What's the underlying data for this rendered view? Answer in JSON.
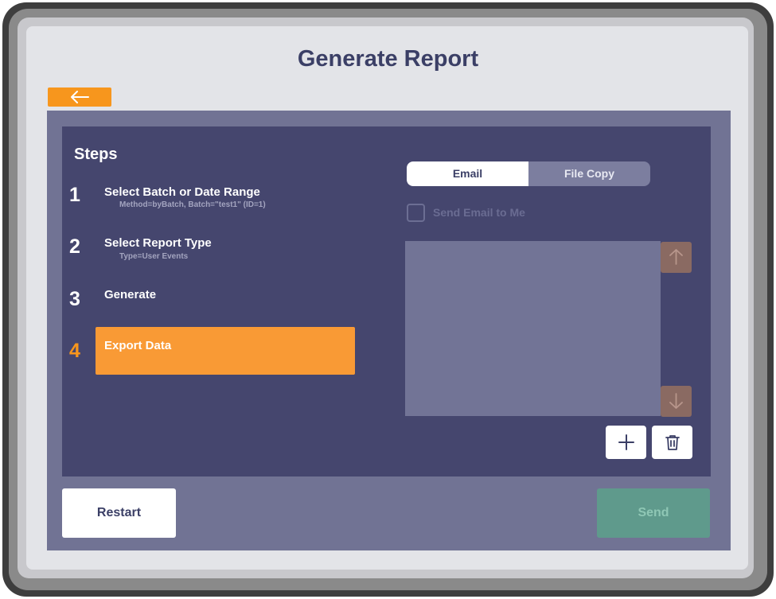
{
  "header": {
    "title": "Generate Report",
    "back_icon": "arrow-left-icon"
  },
  "steps": {
    "heading": "Steps",
    "items": [
      {
        "number": "1",
        "label": "Select Batch or Date Range",
        "detail": "Method=byBatch, Batch=\"test1\" (ID=1)",
        "active": false
      },
      {
        "number": "2",
        "label": "Select Report Type",
        "detail": "Type=User Events",
        "active": false
      },
      {
        "number": "3",
        "label": "Generate",
        "detail": "",
        "active": false
      },
      {
        "number": "4",
        "label": "Export Data",
        "detail": "",
        "active": true
      }
    ]
  },
  "export": {
    "tabs": [
      {
        "label": "Email",
        "selected": true
      },
      {
        "label": "File Copy",
        "selected": false
      }
    ],
    "send_to_me_label": "Send Email to Me",
    "send_to_me_checked": false,
    "recipients": [],
    "scroll_up_icon": "arrow-up-icon",
    "scroll_down_icon": "arrow-down-icon",
    "add_icon": "plus-icon",
    "delete_icon": "trash-icon"
  },
  "footer": {
    "restart_label": "Restart",
    "send_label": "Send",
    "send_enabled": false
  },
  "colors": {
    "accent": "#f7961d",
    "panel": "#45466e",
    "panel_outer": "#717394",
    "title_text": "#3b3f66",
    "send_disabled": "#5f9a8c"
  }
}
